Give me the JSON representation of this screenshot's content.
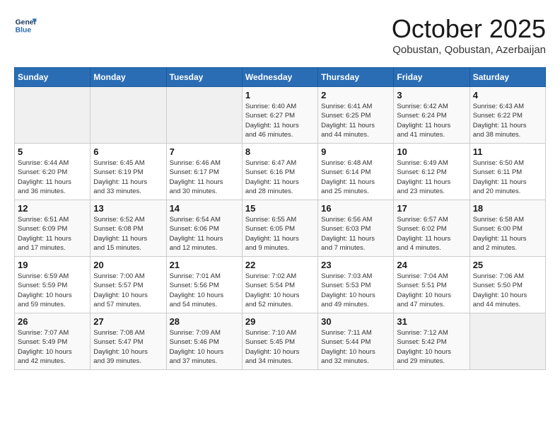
{
  "header": {
    "logo_line1": "General",
    "logo_line2": "Blue",
    "month": "October 2025",
    "location": "Qobustan, Qobustan, Azerbaijan"
  },
  "weekdays": [
    "Sunday",
    "Monday",
    "Tuesday",
    "Wednesday",
    "Thursday",
    "Friday",
    "Saturday"
  ],
  "weeks": [
    [
      {
        "day": "",
        "info": ""
      },
      {
        "day": "",
        "info": ""
      },
      {
        "day": "",
        "info": ""
      },
      {
        "day": "1",
        "info": "Sunrise: 6:40 AM\nSunset: 6:27 PM\nDaylight: 11 hours\nand 46 minutes."
      },
      {
        "day": "2",
        "info": "Sunrise: 6:41 AM\nSunset: 6:25 PM\nDaylight: 11 hours\nand 44 minutes."
      },
      {
        "day": "3",
        "info": "Sunrise: 6:42 AM\nSunset: 6:24 PM\nDaylight: 11 hours\nand 41 minutes."
      },
      {
        "day": "4",
        "info": "Sunrise: 6:43 AM\nSunset: 6:22 PM\nDaylight: 11 hours\nand 38 minutes."
      }
    ],
    [
      {
        "day": "5",
        "info": "Sunrise: 6:44 AM\nSunset: 6:20 PM\nDaylight: 11 hours\nand 36 minutes."
      },
      {
        "day": "6",
        "info": "Sunrise: 6:45 AM\nSunset: 6:19 PM\nDaylight: 11 hours\nand 33 minutes."
      },
      {
        "day": "7",
        "info": "Sunrise: 6:46 AM\nSunset: 6:17 PM\nDaylight: 11 hours\nand 30 minutes."
      },
      {
        "day": "8",
        "info": "Sunrise: 6:47 AM\nSunset: 6:16 PM\nDaylight: 11 hours\nand 28 minutes."
      },
      {
        "day": "9",
        "info": "Sunrise: 6:48 AM\nSunset: 6:14 PM\nDaylight: 11 hours\nand 25 minutes."
      },
      {
        "day": "10",
        "info": "Sunrise: 6:49 AM\nSunset: 6:12 PM\nDaylight: 11 hours\nand 23 minutes."
      },
      {
        "day": "11",
        "info": "Sunrise: 6:50 AM\nSunset: 6:11 PM\nDaylight: 11 hours\nand 20 minutes."
      }
    ],
    [
      {
        "day": "12",
        "info": "Sunrise: 6:51 AM\nSunset: 6:09 PM\nDaylight: 11 hours\nand 17 minutes."
      },
      {
        "day": "13",
        "info": "Sunrise: 6:52 AM\nSunset: 6:08 PM\nDaylight: 11 hours\nand 15 minutes."
      },
      {
        "day": "14",
        "info": "Sunrise: 6:54 AM\nSunset: 6:06 PM\nDaylight: 11 hours\nand 12 minutes."
      },
      {
        "day": "15",
        "info": "Sunrise: 6:55 AM\nSunset: 6:05 PM\nDaylight: 11 hours\nand 9 minutes."
      },
      {
        "day": "16",
        "info": "Sunrise: 6:56 AM\nSunset: 6:03 PM\nDaylight: 11 hours\nand 7 minutes."
      },
      {
        "day": "17",
        "info": "Sunrise: 6:57 AM\nSunset: 6:02 PM\nDaylight: 11 hours\nand 4 minutes."
      },
      {
        "day": "18",
        "info": "Sunrise: 6:58 AM\nSunset: 6:00 PM\nDaylight: 11 hours\nand 2 minutes."
      }
    ],
    [
      {
        "day": "19",
        "info": "Sunrise: 6:59 AM\nSunset: 5:59 PM\nDaylight: 10 hours\nand 59 minutes."
      },
      {
        "day": "20",
        "info": "Sunrise: 7:00 AM\nSunset: 5:57 PM\nDaylight: 10 hours\nand 57 minutes."
      },
      {
        "day": "21",
        "info": "Sunrise: 7:01 AM\nSunset: 5:56 PM\nDaylight: 10 hours\nand 54 minutes."
      },
      {
        "day": "22",
        "info": "Sunrise: 7:02 AM\nSunset: 5:54 PM\nDaylight: 10 hours\nand 52 minutes."
      },
      {
        "day": "23",
        "info": "Sunrise: 7:03 AM\nSunset: 5:53 PM\nDaylight: 10 hours\nand 49 minutes."
      },
      {
        "day": "24",
        "info": "Sunrise: 7:04 AM\nSunset: 5:51 PM\nDaylight: 10 hours\nand 47 minutes."
      },
      {
        "day": "25",
        "info": "Sunrise: 7:06 AM\nSunset: 5:50 PM\nDaylight: 10 hours\nand 44 minutes."
      }
    ],
    [
      {
        "day": "26",
        "info": "Sunrise: 7:07 AM\nSunset: 5:49 PM\nDaylight: 10 hours\nand 42 minutes."
      },
      {
        "day": "27",
        "info": "Sunrise: 7:08 AM\nSunset: 5:47 PM\nDaylight: 10 hours\nand 39 minutes."
      },
      {
        "day": "28",
        "info": "Sunrise: 7:09 AM\nSunset: 5:46 PM\nDaylight: 10 hours\nand 37 minutes."
      },
      {
        "day": "29",
        "info": "Sunrise: 7:10 AM\nSunset: 5:45 PM\nDaylight: 10 hours\nand 34 minutes."
      },
      {
        "day": "30",
        "info": "Sunrise: 7:11 AM\nSunset: 5:44 PM\nDaylight: 10 hours\nand 32 minutes."
      },
      {
        "day": "31",
        "info": "Sunrise: 7:12 AM\nSunset: 5:42 PM\nDaylight: 10 hours\nand 29 minutes."
      },
      {
        "day": "",
        "info": ""
      }
    ]
  ]
}
